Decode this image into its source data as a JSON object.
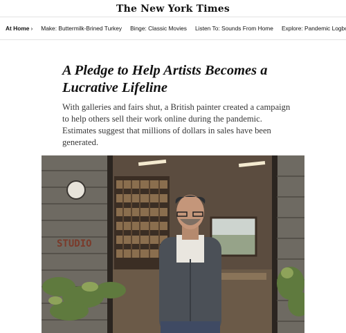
{
  "masthead": {
    "logo_text": "The New York Times"
  },
  "nav": {
    "home_label": "At Home",
    "home_chevron": "›",
    "items": [
      {
        "label": "Make: Buttermilk-Brined Turkey"
      },
      {
        "label": "Binge: Classic Movies"
      },
      {
        "label": "Listen To: Sounds From Home"
      },
      {
        "label": "Explore: Pandemic Logbooks"
      }
    ]
  },
  "article": {
    "headline": "A Pledge to Help Artists Becomes a Lucrative Lifeline",
    "summary": "With galleries and fairs shut, a British painter created a campaign to help others sell their work online during the pandemic. Estimates suggest that millions of dollars in sales have been generated."
  },
  "photo": {
    "sign_text": "STUDIO"
  }
}
